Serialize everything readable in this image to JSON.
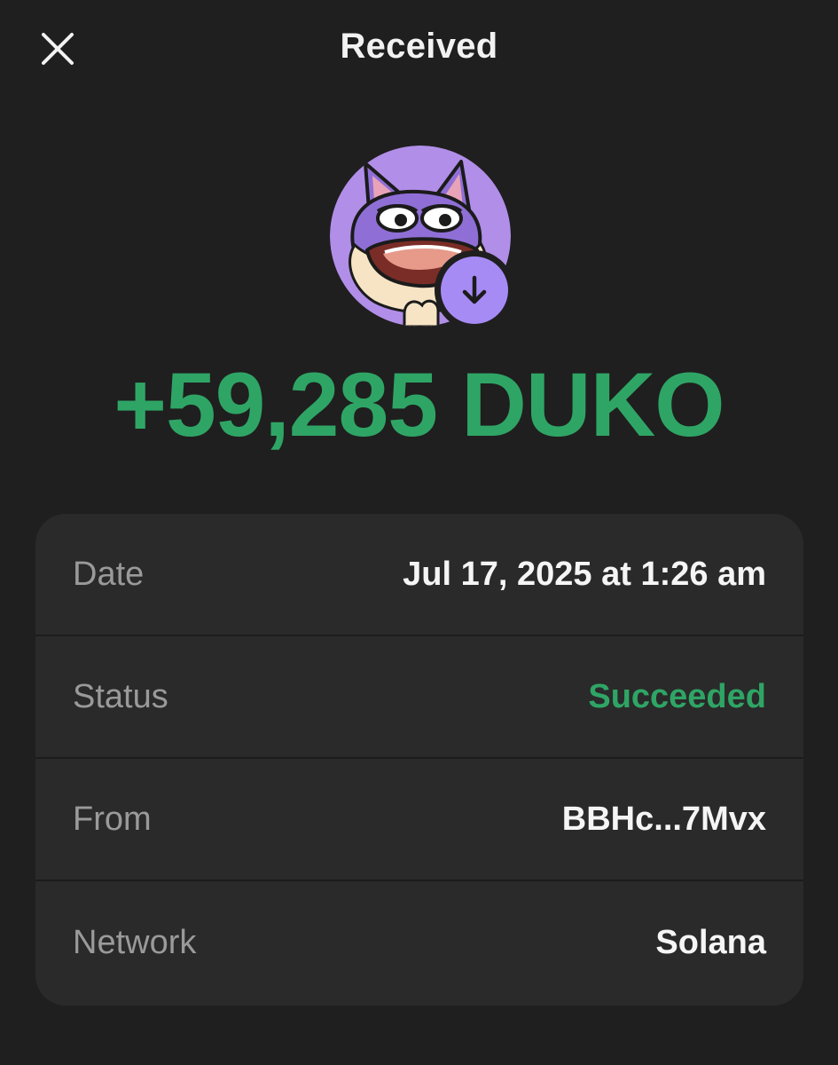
{
  "header": {
    "title": "Received",
    "close_icon": "close-icon"
  },
  "token": {
    "avatar_icon": "duko-token-avatar",
    "badge_icon": "arrow-down-icon",
    "amount": "+59,285 DUKO"
  },
  "details": [
    {
      "label": "Date",
      "value": "Jul 17, 2025 at 1:26 am"
    },
    {
      "label": "Status",
      "value": "Succeeded"
    },
    {
      "label": "From",
      "value": "BBHc...7Mvx"
    },
    {
      "label": "Network",
      "value": "Solana"
    }
  ],
  "colors": {
    "background": "#1f1f1f",
    "card": "#2a2a2a",
    "success_green": "#2fa565",
    "badge_purple": "#a78bf5",
    "avatar_purple": "#b18ee8"
  }
}
